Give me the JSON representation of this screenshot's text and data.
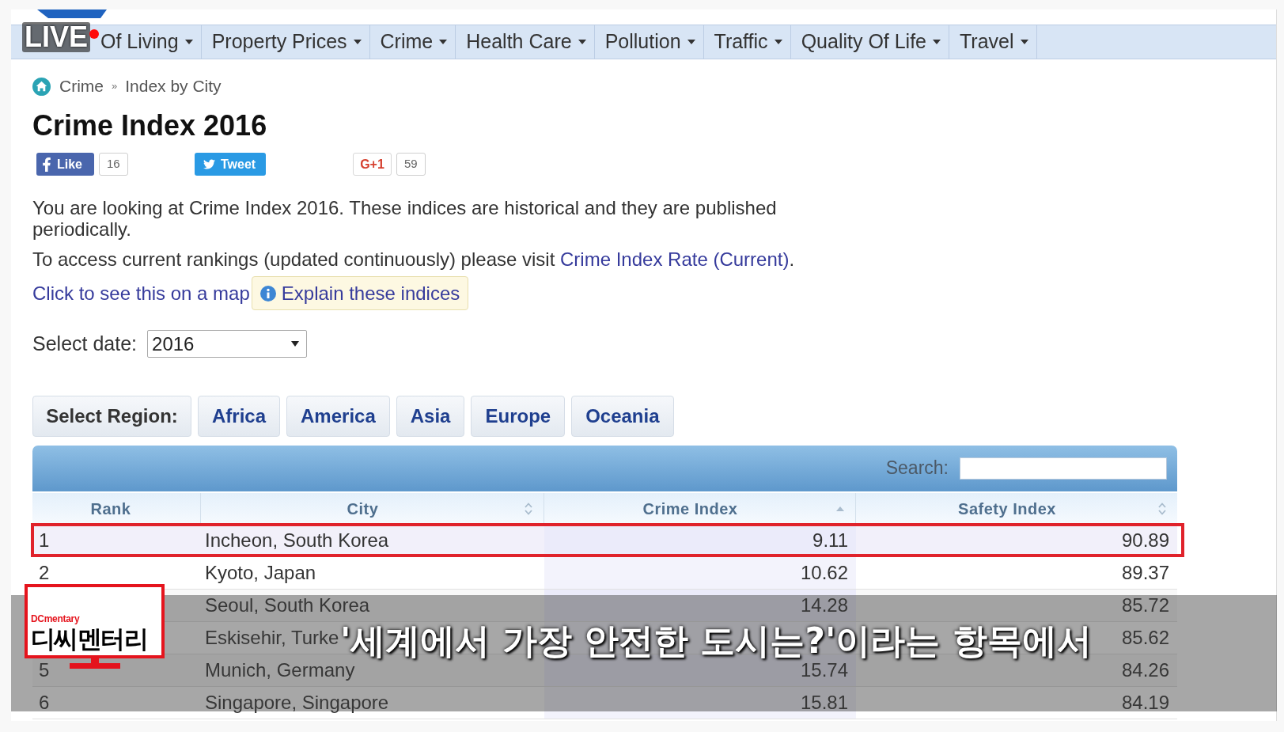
{
  "live_badge": {
    "label": "LIVE"
  },
  "nav": {
    "items": [
      {
        "label": "Of Living"
      },
      {
        "label": "Property Prices"
      },
      {
        "label": "Crime"
      },
      {
        "label": "Health Care"
      },
      {
        "label": "Pollution"
      },
      {
        "label": "Traffic"
      },
      {
        "label": "Quality Of Life"
      },
      {
        "label": "Travel"
      }
    ]
  },
  "breadcrumb": {
    "items": [
      "Crime",
      "Index by City"
    ],
    "separator": "»"
  },
  "title": "Crime Index 2016",
  "social": [
    {
      "kind": "like",
      "label": "Like",
      "count": "16"
    },
    {
      "kind": "tweet",
      "label": "Tweet"
    },
    {
      "kind": "plus_one",
      "label": "G+1",
      "count": "59"
    }
  ],
  "intro": {
    "paragraphs": [
      {
        "text": "You are looking at Crime Index 2016. These indices are historical and they are published periodically."
      },
      {
        "text": "To access current rankings (updated continuously) please visit ",
        "link": "Crime Index Rate (Current)",
        "after": "."
      }
    ]
  },
  "map_link": "Click to see this on a map",
  "explain_button": "Explain these indices",
  "date_select": {
    "label": "Select date:",
    "value": "2016"
  },
  "regions": {
    "label": "Select Region:",
    "items": [
      "Africa",
      "America",
      "Asia",
      "Europe",
      "Oceania"
    ]
  },
  "table": {
    "search": {
      "label": "Search:"
    },
    "columns": [
      {
        "label": "Rank",
        "sortable": false
      },
      {
        "label": "City",
        "sortable": true,
        "sorted": false
      },
      {
        "label": "Crime Index",
        "sortable": true,
        "sorted": true
      },
      {
        "label": "Safety Index",
        "sortable": true,
        "sorted": false
      }
    ],
    "rows": [
      {
        "rank": "1",
        "city": "Incheon, South Korea",
        "crime_index": "9.11",
        "safety_index": "90.89",
        "highlighted": true
      },
      {
        "rank": "2",
        "city": "Kyoto, Japan",
        "crime_index": "10.62",
        "safety_index": "89.37",
        "highlighted": false
      },
      {
        "city": "Seoul, South Korea",
        "crime_index": "14.28",
        "safety_index": "85.72",
        "highlighted": false
      },
      {
        "city": "Eskisehir, Turke",
        "safety_index": "85.62",
        "highlighted": false
      },
      {
        "rank": "5",
        "city": "Munich, Germany",
        "crime_index": "15.74",
        "safety_index": "84.26",
        "highlighted": false
      },
      {
        "rank": "6",
        "city": "Singapore, Singapore",
        "crime_index": "15.81",
        "safety_index": "84.19",
        "highlighted": false
      }
    ]
  },
  "logo": {
    "tag": "DCmentary",
    "name": "디씨멘터리"
  },
  "subtitle": "'세계에서 가장 안전한 도시는?'이라는 항목에서"
}
